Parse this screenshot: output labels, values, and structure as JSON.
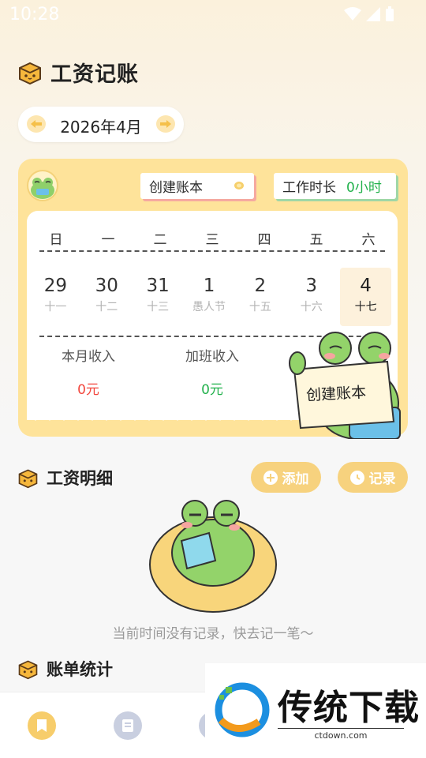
{
  "status_bar": {
    "time": "10:28"
  },
  "header": {
    "title": "工资记账"
  },
  "month_selector": {
    "label": "2026年4月"
  },
  "calendar_card": {
    "create_chip": "创建账本",
    "hours_chip_label": "工作时长",
    "hours_value": "0小时",
    "weekdays": [
      "日",
      "一",
      "二",
      "三",
      "四",
      "五",
      "六"
    ],
    "days": [
      {
        "num": "29",
        "sub": "十一"
      },
      {
        "num": "30",
        "sub": "十二"
      },
      {
        "num": "31",
        "sub": "十三"
      },
      {
        "num": "1",
        "sub": "愚人节"
      },
      {
        "num": "2",
        "sub": "十五"
      },
      {
        "num": "3",
        "sub": "十六"
      },
      {
        "num": "4",
        "sub": "十七"
      }
    ],
    "month_income_label": "本月收入",
    "month_income_value": "0元",
    "overtime_income_label": "加班收入",
    "overtime_income_value": "0元",
    "frog_sign": "创建账本"
  },
  "detail_section": {
    "title": "工资明细",
    "add_button": "添加",
    "record_button": "记录",
    "empty_text": "当前时间没有记录，快去记一笔～"
  },
  "stats_section": {
    "title": "账单统计"
  },
  "watermark": {
    "brand": "传统下载",
    "url": "ctdown.com"
  },
  "colors": {
    "accent_yellow": "#fee39a",
    "button_yellow": "#f7d27e",
    "income_red": "#f2463d",
    "income_green": "#22b14c"
  }
}
